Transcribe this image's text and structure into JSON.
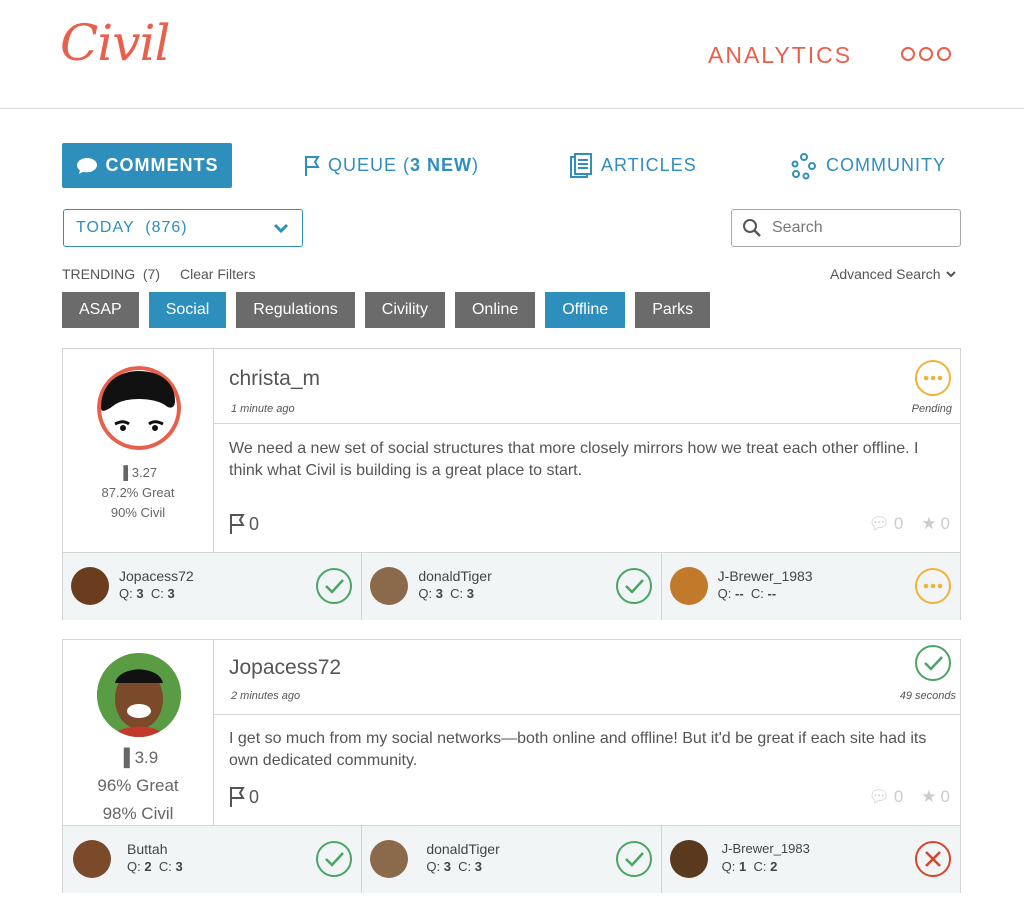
{
  "app": {
    "logo": "Civil",
    "analytics": "ANALYTICS"
  },
  "tabs": {
    "comments": "COMMENTS",
    "queue": "QUEUE (",
    "queue_new": "3 NEW",
    "queue_close": ")",
    "articles": "ARTICLES",
    "community": "COMMUNITY"
  },
  "filters": {
    "date_select": "TODAY  (876)",
    "search_placeholder": "Search",
    "trending": "TRENDING  (7)",
    "clear": "Clear Filters",
    "advanced": "Advanced Search",
    "tags": [
      {
        "label": "ASAP",
        "selected": false
      },
      {
        "label": "Social",
        "selected": true
      },
      {
        "label": "Regulations",
        "selected": false
      },
      {
        "label": "Civility",
        "selected": false
      },
      {
        "label": "Online",
        "selected": false
      },
      {
        "label": "Offline",
        "selected": true
      },
      {
        "label": "Parks",
        "selected": false
      }
    ]
  },
  "comments": [
    {
      "user": "christa_m",
      "time": "1 minute ago",
      "status": "Pending",
      "text": "We need a new set of social structures that more closely mirrors how we treat each other offline. I think what Civil is building is a great place to start.",
      "flags": "0",
      "replies": "0",
      "stars": "0",
      "score": "3.27",
      "great": "87.2% Great",
      "civil": "90% Civil",
      "reviewers": [
        {
          "name": "Jopacess72",
          "q_label": "Q:",
          "q": "3",
          "c_label": "C:",
          "c": "3",
          "status": "approved"
        },
        {
          "name": "donaldTiger",
          "q_label": "Q:",
          "q": "3",
          "c_label": "C:",
          "c": "3",
          "status": "approved"
        },
        {
          "name": "J-Brewer_1983",
          "q_label": "Q:",
          "q": "--",
          "c_label": "C:",
          "c": "--",
          "status": "pending"
        }
      ]
    },
    {
      "user": "Jopacess72",
      "time": "2 minutes ago",
      "status": "49 seconds",
      "text": "I get so much from my social networks—both online and offline! But it'd be great if each site had its own dedicated community.",
      "flags": "0",
      "replies": "0",
      "stars": "0",
      "score": "3.9",
      "great": "96% Great",
      "civil": "98% Civil",
      "reviewers": [
        {
          "name": "Buttah",
          "q_label": "Q:",
          "q": "2",
          "c_label": "C:",
          "c": "3",
          "status": "approved"
        },
        {
          "name": "donaldTiger",
          "q_label": "Q:",
          "q": "3",
          "c_label": "C:",
          "c": "3",
          "status": "approved"
        },
        {
          "name": "J-Brewer_1983",
          "q_label": "Q:",
          "q": "1",
          "c_label": "C:",
          "c": "2",
          "status": "rejected"
        }
      ]
    }
  ],
  "colors": {
    "accent": "#e8604c",
    "blue": "#2e8fbd",
    "green": "#4aa564",
    "orange": "#f2b13b",
    "red": "#d8442c"
  }
}
